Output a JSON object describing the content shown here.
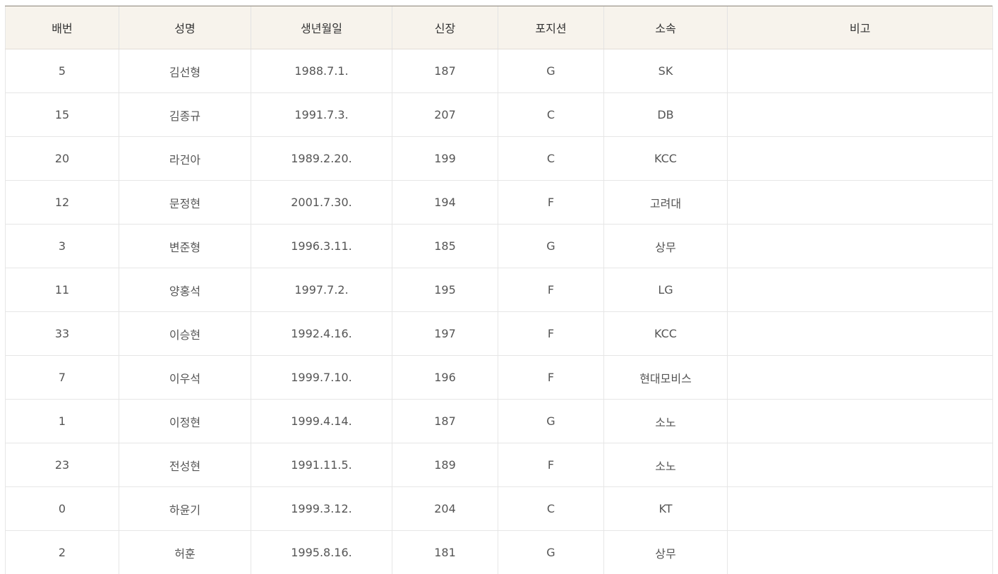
{
  "table": {
    "columns": [
      "배번",
      "성명",
      "생년월일",
      "신장",
      "포지션",
      "소속",
      "비고"
    ],
    "rows": [
      {
        "number": "5",
        "name": "김선형",
        "birth": "1988.7.1.",
        "height": "187",
        "position": "G",
        "team": "SK",
        "note": ""
      },
      {
        "number": "15",
        "name": "김종규",
        "birth": "1991.7.3.",
        "height": "207",
        "position": "C",
        "team": "DB",
        "note": ""
      },
      {
        "number": "20",
        "name": "라건아",
        "birth": "1989.2.20.",
        "height": "199",
        "position": "C",
        "team": "KCC",
        "note": ""
      },
      {
        "number": "12",
        "name": "문정현",
        "birth": "2001.7.30.",
        "height": "194",
        "position": "F",
        "team": "고려대",
        "note": ""
      },
      {
        "number": "3",
        "name": "변준형",
        "birth": "1996.3.11.",
        "height": "185",
        "position": "G",
        "team": "상무",
        "note": ""
      },
      {
        "number": "11",
        "name": "양홍석",
        "birth": "1997.7.2.",
        "height": "195",
        "position": "F",
        "team": "LG",
        "note": ""
      },
      {
        "number": "33",
        "name": "이승현",
        "birth": "1992.4.16.",
        "height": "197",
        "position": "F",
        "team": "KCC",
        "note": ""
      },
      {
        "number": "7",
        "name": "이우석",
        "birth": "1999.7.10.",
        "height": "196",
        "position": "F",
        "team": "현대모비스",
        "note": ""
      },
      {
        "number": "1",
        "name": "이정현",
        "birth": "1999.4.14.",
        "height": "187",
        "position": "G",
        "team": "소노",
        "note": ""
      },
      {
        "number": "23",
        "name": "전성현",
        "birth": "1991.11.5.",
        "height": "189",
        "position": "F",
        "team": "소노",
        "note": ""
      },
      {
        "number": "0",
        "name": "하윤기",
        "birth": "1999.3.12.",
        "height": "204",
        "position": "C",
        "team": "KT",
        "note": ""
      },
      {
        "number": "2",
        "name": "허훈",
        "birth": "1995.8.16.",
        "height": "181",
        "position": "G",
        "team": "상무",
        "note": ""
      }
    ]
  },
  "colors": {
    "header_background": "#f7f3ec",
    "header_top_border": "#8a8378",
    "cell_border": "#e6e6e6",
    "text": "#555555"
  }
}
